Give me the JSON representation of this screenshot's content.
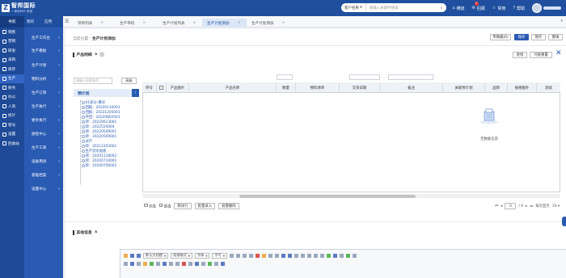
{
  "app": {
    "logo_letter": "Z",
    "title": "智邦国际",
    "subtitle": "一体化ERP 系统"
  },
  "topbar": {
    "search_select": "客户名称",
    "search_placeholder": "请输入关键字搜索",
    "actions": [
      {
        "label": "横道"
      },
      {
        "label": "回报",
        "badge": "2"
      },
      {
        "label": "常用"
      },
      {
        "label": "帮助"
      }
    ]
  },
  "rail": {
    "head": "导航",
    "items": [
      "销售",
      "营销",
      "研发",
      "采购",
      "库存",
      "生产",
      "财务",
      "办公",
      "人资",
      "统计",
      "客号",
      "设置",
      "回收站"
    ]
  },
  "submenu": {
    "head_left": "我的",
    "head_right": "应用",
    "items": [
      "生产工作台",
      "生产看板",
      "生产计划",
      "物料分析",
      "生产订单",
      "生产执行",
      "委外执行",
      "质检中心",
      "生产工资",
      "设备用具",
      "基础档案",
      "设置中心"
    ]
  },
  "tabs": [
    "项目列表",
    "生产带机",
    "生产计划列表",
    "生产计划添加",
    "生产计划添加"
  ],
  "breadcrumb": {
    "prefix": "当前位置：",
    "current": "生产计划添加"
  },
  "header_buttons": [
    "草稿箱(0)",
    "保存",
    "暂存",
    "重填"
  ],
  "product_section": {
    "title": "产品明细",
    "find_btn": "查找",
    "reset_btn": "列宽重置"
  },
  "tree": {
    "search_placeholder": "请输入检索条件",
    "search_btn": "高级",
    "head": "预计划",
    "nodes": [
      "01部分-模块",
      "回报：20240130001",
      "回报：20231205001",
      "传回：20220802001",
      "转：20220613001",
      "转：2022524004",
      "转：20220509001",
      "转：20220509001",
      "试产",
      "转：20211203001",
      "生产流水面板",
      "转：20201118002",
      "转：20200710001",
      "转：20200706002"
    ]
  },
  "grid": {
    "columns": [
      "序号",
      "",
      "产品图片",
      "产品名称",
      "数量",
      "物料清单",
      "交货日期",
      "备注",
      "关联预计划",
      "品牌",
      "规格额外",
      "测试"
    ],
    "empty_text": "无数据信息"
  },
  "grid_footer": {
    "select_all": "全选",
    "invert": "反选",
    "buttons": [
      "移动行",
      "批量录入",
      "批量删除"
    ],
    "page_current": "0",
    "page_total": "/ 0",
    "per_page_label": "每页显示",
    "per_page_value": "10"
  },
  "other_section": {
    "title": "其他信息"
  },
  "editor": {
    "row1_selects": [
      "段落格式",
      "字体",
      "字号"
    ],
    "row1_first": "默认文档题"
  }
}
